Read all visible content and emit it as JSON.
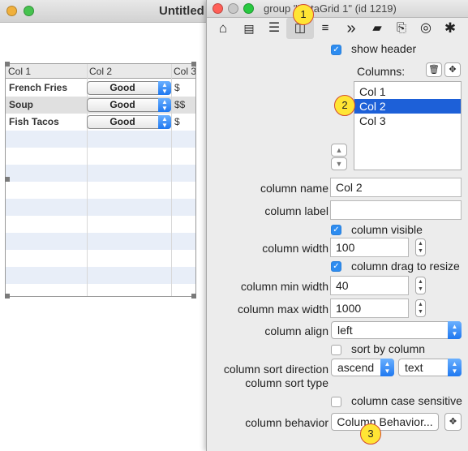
{
  "background_window": {
    "title": "Untitled",
    "columns": [
      "Col 1",
      "Col 2",
      "Col 3"
    ],
    "rows": [
      {
        "col1": "French Fries",
        "col2": "Good",
        "col3": "$"
      },
      {
        "col1": "Soup",
        "col2": "Good",
        "col3": "$$"
      },
      {
        "col1": "Fish Tacos",
        "col2": "Good",
        "col3": "$"
      }
    ]
  },
  "inspector": {
    "title": "group \"DataGrid 1\" (id 1219)",
    "toolbar_icons": [
      "home-icon",
      "card-icon",
      "list-icon",
      "columns-icon",
      "database-icon",
      "chevron-right-double-icon",
      "lock-icon",
      "script-icon",
      "target-icon",
      "gear-icon"
    ],
    "show_header": {
      "label": "show header",
      "checked": true
    },
    "columns_label": "Columns:",
    "columns_list": [
      "Col 1",
      "Col 2",
      "Col 3"
    ],
    "selected_column": "Col 2",
    "column_name": {
      "label": "column name",
      "value": "Col 2"
    },
    "column_label": {
      "label": "column label",
      "value": ""
    },
    "column_visible": {
      "label": "column visible",
      "checked": true
    },
    "column_width": {
      "label": "column width",
      "value": "100"
    },
    "column_drag": {
      "label": "column drag to resize",
      "checked": true
    },
    "column_min_width": {
      "label": "column min width",
      "value": "40"
    },
    "column_max_width": {
      "label": "column max width",
      "value": "1000"
    },
    "column_align": {
      "label": "column align",
      "value": "left"
    },
    "sort_by_column": {
      "label": "sort by column",
      "checked": false
    },
    "sort_direction": {
      "label": "column sort direction",
      "value": "ascend"
    },
    "sort_type": {
      "label": "column sort type",
      "value": "text"
    },
    "case_sensitive": {
      "label": "column case sensitive",
      "checked": false
    },
    "column_behavior": {
      "label": "column behavior",
      "button": "Column Behavior..."
    }
  },
  "badges": [
    "1",
    "2",
    "3"
  ]
}
